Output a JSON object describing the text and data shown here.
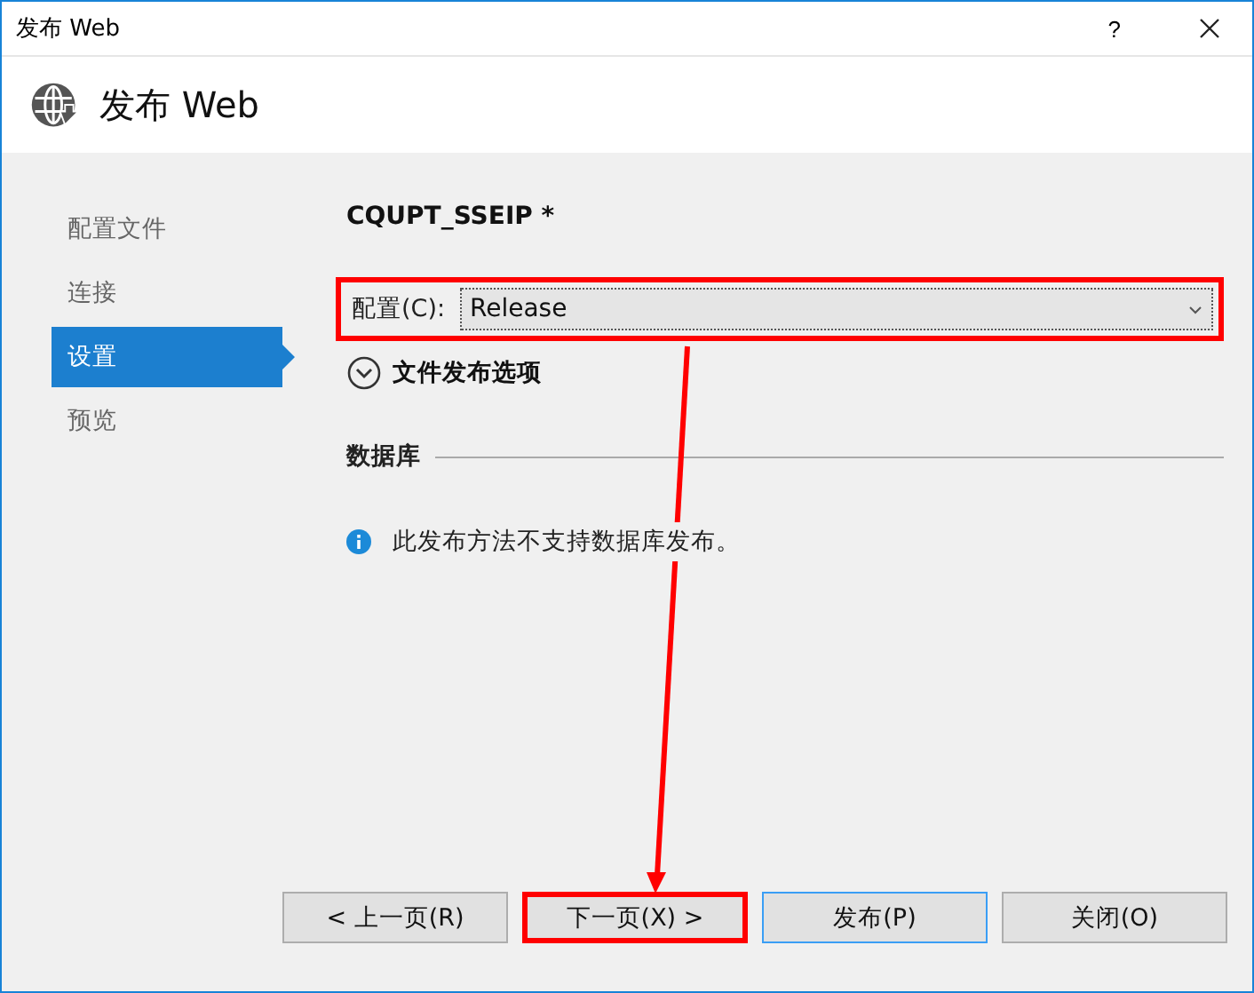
{
  "window": {
    "title": "发布 Web",
    "help": "?"
  },
  "header": {
    "title": "发布 Web"
  },
  "sidebar": {
    "items": [
      {
        "label": "配置文件",
        "selected": false
      },
      {
        "label": "连接",
        "selected": false
      },
      {
        "label": "设置",
        "selected": true
      },
      {
        "label": "预览",
        "selected": false
      }
    ]
  },
  "profile_name": "CQUPT_SSEIP *",
  "configuration": {
    "label": "配置(C):",
    "value": "Release",
    "highlighted": true
  },
  "file_publish_options": {
    "label": "文件发布选项",
    "expanded": false
  },
  "database": {
    "heading": "数据库",
    "info": "此发布方法不支持数据库发布。"
  },
  "buttons": [
    {
      "label": "< 上一页(R)",
      "focused": false,
      "highlighted": false
    },
    {
      "label": "下一页(X) >",
      "focused": false,
      "highlighted": true
    },
    {
      "label": "发布(P)",
      "focused": true,
      "highlighted": false
    },
    {
      "label": "关闭(O)",
      "focused": false,
      "highlighted": false
    }
  ]
}
